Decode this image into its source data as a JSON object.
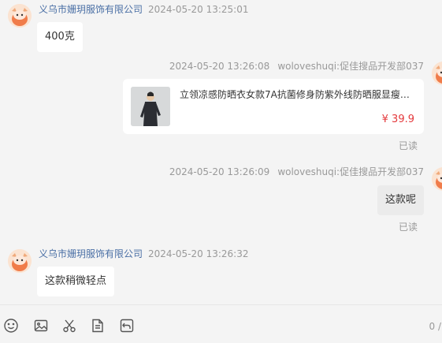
{
  "messages": [
    {
      "sender": "义乌市姗玥服饰有限公司",
      "time": "2024-05-20 13:25:01",
      "text": "400克"
    },
    {
      "time": "2024-05-20 13:26:08",
      "sender": "woloveshuqi:促佳搜品开发部037",
      "product_title": "立领凉感防晒衣女款7A抗菌修身防紫外线防晒服显瘦冰…",
      "product_price": "¥ 39.9",
      "status": "已读"
    },
    {
      "time": "2024-05-20 13:26:09",
      "sender": "woloveshuqi:促佳搜品开发部037",
      "text": "这款呢",
      "status": "已读"
    },
    {
      "sender": "义乌市姗玥服饰有限公司",
      "time": "2024-05-20 13:26:32",
      "text": "这款稍微轻点"
    }
  ],
  "toolbar": {
    "icons": [
      "emoji-icon",
      "image-icon",
      "scissors-icon",
      "document-icon",
      "history-icon"
    ],
    "counter": "0 /"
  },
  "colors": {
    "background": "#f4f4f4",
    "sender_name": "#4a6fa5",
    "price": "#e4393c",
    "self_bubble": "#ebebeb"
  }
}
